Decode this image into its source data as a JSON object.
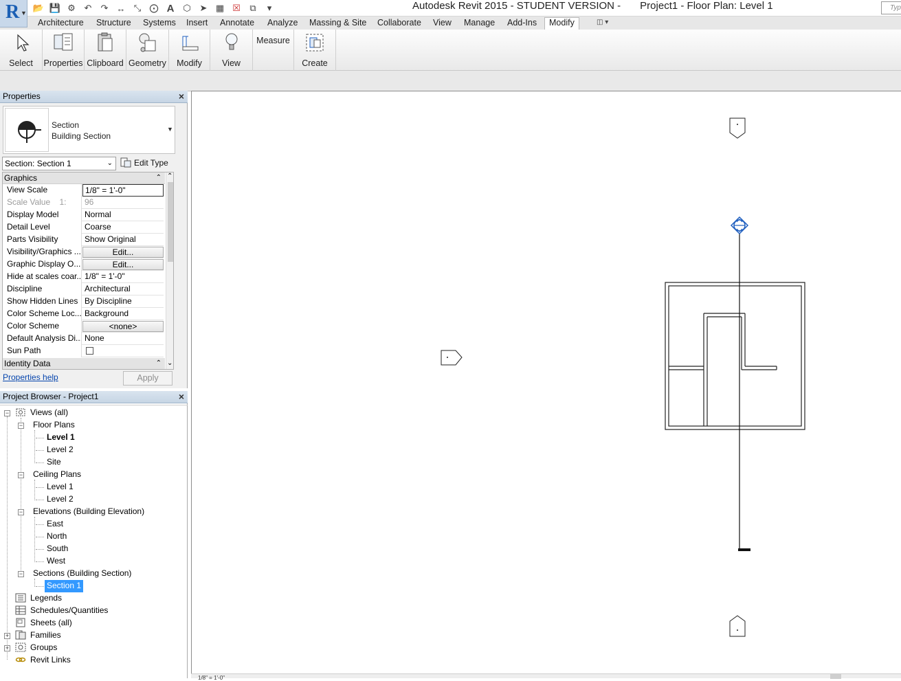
{
  "title_bar": {
    "app_name": "Autodesk Revit 2015 - STUDENT VERSION -",
    "document": "Project1 - Floor Plan: Level 1",
    "search_placeholder": "Typ"
  },
  "qat_icons": [
    "open-icon",
    "save-icon",
    "sync-icon",
    "undo-icon",
    "redo-icon",
    "measure-icon",
    "dimension-icon",
    "tag-icon",
    "text-icon",
    "3d-view-icon",
    "section-icon",
    "thin-lines-icon",
    "close-hidden-icon",
    "switch-windows-icon",
    "customize-icon"
  ],
  "ribbon_tabs": [
    "Architecture",
    "Structure",
    "Systems",
    "Insert",
    "Annotate",
    "Analyze",
    "Massing & Site",
    "Collaborate",
    "View",
    "Manage",
    "Add-Ins",
    "Modify"
  ],
  "active_tab": "Modify",
  "ribbon_panels": [
    "Select",
    "Properties",
    "Clipboard",
    "Geometry",
    "Modify",
    "View",
    "Measure",
    "Create"
  ],
  "properties": {
    "title": "Properties",
    "type_family": "Section",
    "type_name": "Building Section",
    "instance_filter": "Section: Section 1",
    "edit_type": "Edit Type",
    "groups": {
      "graphics": "Graphics",
      "identity": "Identity Data"
    },
    "rows": [
      {
        "name": "View Scale",
        "value": "1/8\" = 1'-0\""
      },
      {
        "name": "Scale Value    1:",
        "value": "96"
      },
      {
        "name": "Display Model",
        "value": "Normal"
      },
      {
        "name": "Detail Level",
        "value": "Coarse"
      },
      {
        "name": "Parts Visibility",
        "value": "Show Original"
      },
      {
        "name": "Visibility/Graphics ...",
        "value": "Edit..."
      },
      {
        "name": "Graphic Display O...",
        "value": "Edit..."
      },
      {
        "name": "Hide at scales coar...",
        "value": "1/8\" = 1'-0\""
      },
      {
        "name": "Discipline",
        "value": "Architectural"
      },
      {
        "name": "Show Hidden Lines",
        "value": "By Discipline"
      },
      {
        "name": "Color Scheme Loc...",
        "value": "Background"
      },
      {
        "name": "Color Scheme",
        "value": "<none>"
      },
      {
        "name": "Default Analysis Di...",
        "value": "None"
      },
      {
        "name": "Sun Path",
        "value": ""
      }
    ],
    "help_link": "Properties help",
    "apply": "Apply"
  },
  "browser": {
    "title": "Project Browser - Project1",
    "tree": [
      {
        "label": "Views (all)"
      },
      {
        "label": "Floor Plans"
      },
      {
        "label": "Level 1"
      },
      {
        "label": "Level 2"
      },
      {
        "label": "Site"
      },
      {
        "label": "Ceiling Plans"
      },
      {
        "label": "Level 1"
      },
      {
        "label": "Level 2"
      },
      {
        "label": "Elevations (Building Elevation)"
      },
      {
        "label": "East"
      },
      {
        "label": "North"
      },
      {
        "label": "South"
      },
      {
        "label": "West"
      },
      {
        "label": "Sections (Building Section)"
      },
      {
        "label": "Section 1"
      },
      {
        "label": "Legends"
      },
      {
        "label": "Schedules/Quantities"
      },
      {
        "label": "Sheets (all)"
      },
      {
        "label": "Families"
      },
      {
        "label": "Groups"
      },
      {
        "label": "Revit Links"
      }
    ]
  },
  "view_controls": {
    "scale": "1/8\" = 1'-0\""
  },
  "colors": {
    "selection": "#3399ff",
    "selected_section_head": "#1f5fbf",
    "palette_header": "#c6d5e4"
  }
}
